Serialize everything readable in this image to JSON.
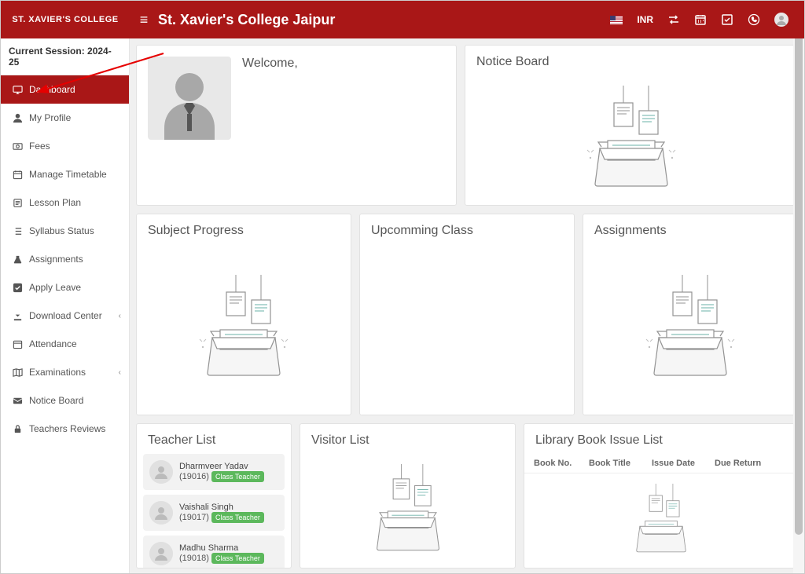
{
  "header": {
    "logo_text": "ST. XAVIER'S COLLEGE",
    "title": "St. Xavier's College Jaipur",
    "currency": "INR"
  },
  "sidebar": {
    "session_label": "Current Session: 2024-25",
    "items": [
      {
        "label": "Dashboard",
        "icon": "monitor"
      },
      {
        "label": "My Profile",
        "icon": "user"
      },
      {
        "label": "Fees",
        "icon": "money"
      },
      {
        "label": "Manage Timetable",
        "icon": "calendar"
      },
      {
        "label": "Lesson Plan",
        "icon": "book"
      },
      {
        "label": "Syllabus Status",
        "icon": "list"
      },
      {
        "label": "Assignments",
        "icon": "flask"
      },
      {
        "label": "Apply Leave",
        "icon": "check"
      },
      {
        "label": "Download Center",
        "icon": "download",
        "chevron": true
      },
      {
        "label": "Attendance",
        "icon": "calendar"
      },
      {
        "label": "Examinations",
        "icon": "map",
        "chevron": true
      },
      {
        "label": "Notice Board",
        "icon": "envelope"
      },
      {
        "label": "Teachers Reviews",
        "icon": "lock"
      }
    ]
  },
  "cards": {
    "welcome_title": "Welcome,",
    "notice_title": "Notice Board",
    "progress_title": "Subject Progress",
    "upcoming_title": "Upcomming Class",
    "assignments_title": "Assignments",
    "teacher_title": "Teacher List",
    "visitor_title": "Visitor List",
    "library_title": "Library Book Issue List"
  },
  "teachers": [
    {
      "name": "Dharmveer Yadav",
      "id": "(19016)",
      "badge": "Class Teacher"
    },
    {
      "name": "Vaishali Singh",
      "id": "(19017)",
      "badge": "Class Teacher"
    },
    {
      "name": "Madhu Sharma",
      "id": "(19018)",
      "badge": "Class Teacher"
    }
  ],
  "library_headers": [
    "Book No.",
    "Book Title",
    "Issue Date",
    "Due Return"
  ]
}
